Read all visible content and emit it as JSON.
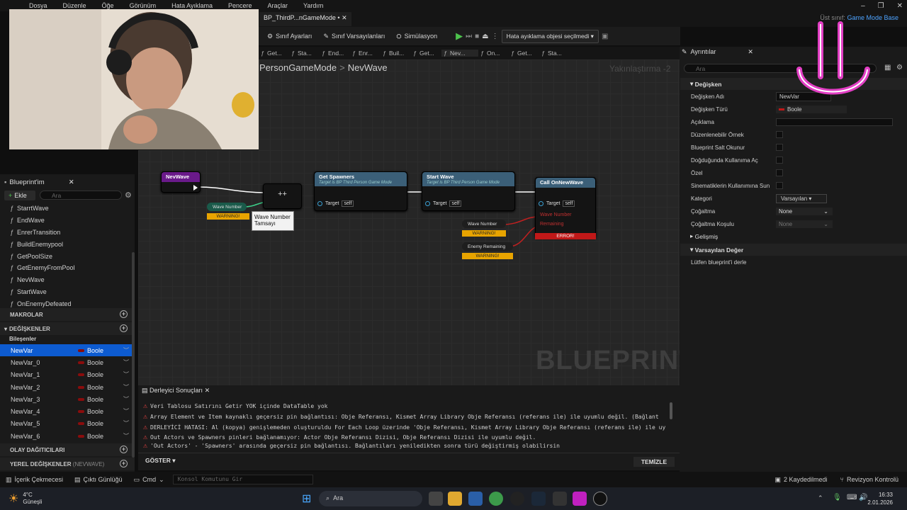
{
  "menu": [
    "Dosya",
    "Düzenle",
    "Öğe",
    "Görünüm",
    "Hata Ayıklama",
    "Pencere",
    "Araçlar",
    "Yardım"
  ],
  "doc_tab": "BP_ThirdP...nGameMode •",
  "parent_class": {
    "label": "Üst sınıf:",
    "value": "Game Mode Base"
  },
  "toolbar": {
    "class_settings": "Sınıf Ayarları",
    "class_defaults": "Sınıf Varsayılanları",
    "simulation": "Simülasyon",
    "debug_object": "Hata ayıklama objesi seçilmedi"
  },
  "function_tabs": [
    "Get...",
    "Sta...",
    "End...",
    "Enr...",
    "Buil...",
    "Get...",
    "Nev...",
    "On...",
    "Get...",
    "Sta..."
  ],
  "breadcrumb": {
    "parent": "PersonGameMode",
    "current": "NevWave"
  },
  "zoom": "Yakınlaştırma -2",
  "watermark": "BLUEPRINT",
  "my_blueprint": {
    "title": "Blueprint'im",
    "add": "Ekle",
    "search": "Ara"
  },
  "functions": [
    "StarrtWave",
    "EndWave",
    "EnrerTransition",
    "BuildEnemypool",
    "GetPoolSize",
    "GetEnemyFromPool",
    "NevWave",
    "StartWave",
    "OnEnemyDefeated"
  ],
  "sections": {
    "macros": "MAKROLAR",
    "variables": "DEĞİŞKENLER",
    "components": "Bileşenler",
    "dispatchers": "OLAY DAĞITICILARI",
    "local_vars": "YEREL DEĞİŞKENLER",
    "local_vars_sub": "(NEVWAVE)"
  },
  "variables": [
    {
      "name": "NewVar",
      "type": "Boole"
    },
    {
      "name": "NewVar_0",
      "type": "Boole"
    },
    {
      "name": "NewVar_1",
      "type": "Boole"
    },
    {
      "name": "NewVar_2",
      "type": "Boole"
    },
    {
      "name": "NewVar_3",
      "type": "Boole"
    },
    {
      "name": "NewVar_4",
      "type": "Boole"
    },
    {
      "name": "NewVar_5",
      "type": "Boole"
    },
    {
      "name": "NewVar_6",
      "type": "Boole"
    }
  ],
  "nodes": {
    "entry": "NevWave",
    "get_spawners": "Get Spawners",
    "get_spawners_sub": "Target is BP Third Person Game Mode",
    "start_wave": "Start Wave",
    "start_wave_sub": "Target is BP Third Person Game Mode",
    "call_on_new_wave": "Call OnNewWave",
    "target": "Target",
    "self": "self",
    "wave_number": "Wave Number",
    "enemy_remaining": "Enemy Remaining",
    "pin_wave_number": "Wave Number",
    "pin_remaining": "Remaining",
    "warning": "WARNING!",
    "error": "ERROR!"
  },
  "tooltip": "Wave Number Tamsayı",
  "details": {
    "title": "Ayrıntılar",
    "search": "Ara",
    "sec_variable": "Değişken",
    "sec_advanced": "Gelişmiş",
    "sec_default": "Varsayılan Değer",
    "rows": [
      {
        "label": "Değişken Adı",
        "value": "NewVar"
      },
      {
        "label": "Değişken Türü",
        "value": "Boole"
      },
      {
        "label": "Açıklama",
        "value": ""
      },
      {
        "label": "Düzenlenebilir Örnek",
        "value": ""
      },
      {
        "label": "Blueprint Salt Okunur",
        "value": ""
      },
      {
        "label": "Doğduğunda Kullanıma Aç",
        "value": ""
      },
      {
        "label": "Özel",
        "value": ""
      },
      {
        "label": "Sinematiklerin Kullanımına Sun",
        "value": ""
      },
      {
        "label": "Kategori",
        "value": "Varsayılan"
      },
      {
        "label": "Çoğaltma",
        "value": "None"
      },
      {
        "label": "Çoğaltma Koşulu",
        "value": "None"
      }
    ],
    "compile_msg": "Lütfen blueprint'i derle"
  },
  "compiler": {
    "tab": "Derleyici Sonuçları",
    "lines": [
      "Veri Tablosu Satırını Getir YOK içinde DataTable yok",
      "Array Element ve Item kaynaklı geçersiz pin bağlantısı: Obje Referansı, Kismet Array Library Obje Referansı (referans ile) ile uyumlu değil. (Bağlant",
      "DERLEYİCİ HATASI: Al (kopya) genişlemeden oluşturuldu For Each Loop üzerinde 'Obje Referansı, Kismet Array Library Obje Referansı (referans ile) ile uy",
      "Out Actors ve Spawners pinleri bağlanamıyor: Actor Obje Referansı Dizisi, Obje Referansı Dizisi ile uyumlu değil.",
      "'Out Actors' - 'Spawners' arasında geçersiz pin bağlantısı. Bağlantıları yeniledikten sonra türü değiştirmiş olabilirsin"
    ],
    "show": "GÖSTER",
    "clear": "TEMİZLE"
  },
  "status": {
    "content_drawer": "İçerik Çekmecesi",
    "output_log": "Çıktı Günlüğü",
    "cmd": "Cmd",
    "console": "Konsol Komutunu Gir",
    "saved": "2 Kaydedilmedi",
    "revision": "Revizyon Kontrolü"
  },
  "taskbar": {
    "temp": "4°C",
    "weather": "Güneşli",
    "search": "Ara",
    "time": "16:33",
    "date": "2.01.2026"
  }
}
